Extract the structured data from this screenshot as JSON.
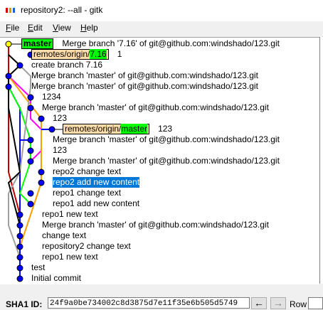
{
  "window": {
    "title": "repository2: --all - gitk",
    "icon_colors": [
      "#d40000",
      "#d4a000",
      "#2060d0"
    ]
  },
  "menu": [
    {
      "label": "File",
      "accel": "F",
      "rest": "ile"
    },
    {
      "label": "Edit",
      "accel": "E",
      "rest": "dit"
    },
    {
      "label": "View",
      "accel": "V",
      "rest": "iew"
    },
    {
      "label": "Help",
      "accel": "H",
      "rest": "elp"
    }
  ],
  "commits": [
    {
      "refs": [
        {
          "kind": "local",
          "name": "master"
        }
      ],
      "message": "Merge branch '7.16' of git@github.com:windshado/123.git"
    },
    {
      "refs": [
        {
          "kind": "remote",
          "prefix": "remotes/origin/",
          "name": "7.16"
        }
      ],
      "message": "1"
    },
    {
      "refs": [],
      "message": "create branch 7.16"
    },
    {
      "refs": [],
      "message": "Merge branch 'master' of git@github.com:windshado/123.git"
    },
    {
      "refs": [],
      "message": "Merge branch 'master' of git@github.com:windshado/123.git"
    },
    {
      "refs": [],
      "message": "1234"
    },
    {
      "refs": [],
      "message": "Merge branch 'master' of git@github.com:windshado/123.git"
    },
    {
      "refs": [],
      "message": "123"
    },
    {
      "refs": [
        {
          "kind": "remote",
          "prefix": "remotes/origin/",
          "name": "master"
        }
      ],
      "message": "123"
    },
    {
      "refs": [],
      "message": "Merge branch 'master' of git@github.com:windshado/123.git"
    },
    {
      "refs": [],
      "message": "123"
    },
    {
      "refs": [],
      "message": "Merge branch 'master' of git@github.com:windshado/123.git"
    },
    {
      "refs": [],
      "message": "repo2 change text"
    },
    {
      "refs": [],
      "message": "repo2 add new content",
      "selected": true
    },
    {
      "refs": [],
      "message": "repo1 change text"
    },
    {
      "refs": [],
      "message": "repo1 add new content"
    },
    {
      "refs": [],
      "message": "repo1 new text"
    },
    {
      "refs": [],
      "message": "Merge branch 'master' of git@github.com:windshado/123.git"
    },
    {
      "refs": [],
      "message": "change text"
    },
    {
      "refs": [],
      "message": "repository2 change text"
    },
    {
      "refs": [],
      "message": "repo1 new text"
    },
    {
      "refs": [],
      "message": "test"
    },
    {
      "refs": [],
      "message": "Initial commit"
    }
  ],
  "graph_colors": {
    "head": "#ffff00",
    "node": "#0000ff",
    "lane_blue": "#0000ff",
    "lane_red": "#c00000",
    "lane_magenta": "#ff00ff",
    "lane_green": "#00ff00",
    "lane_orange": "#ffa000",
    "lane_gray": "#a0a0a0",
    "lane_black": "#000000"
  },
  "sha": {
    "label": "SHA1 ID:",
    "value": "24f9a0be734002c8d3875d7e11f35e6b505d5749"
  },
  "nav": {
    "back": "←",
    "forward": "→"
  },
  "row": {
    "label": "Row"
  }
}
